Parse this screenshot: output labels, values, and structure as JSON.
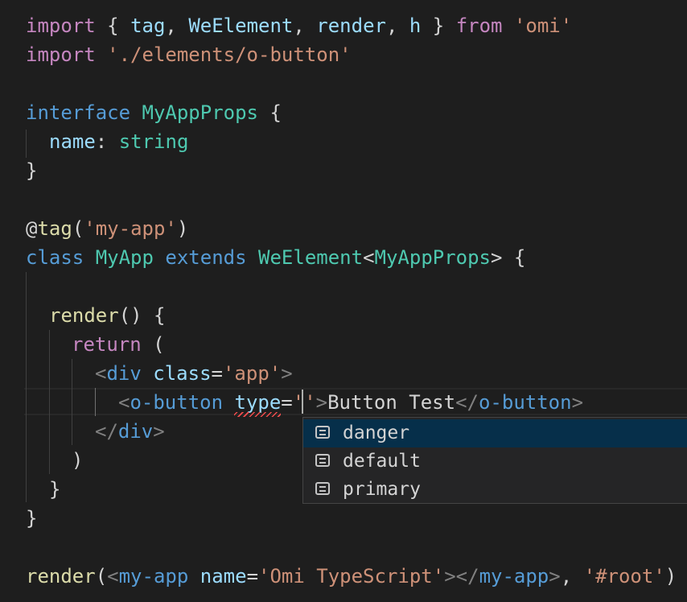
{
  "code": {
    "line1": {
      "k1": "import",
      "p1": " { ",
      "v1": "tag",
      "p2": ", ",
      "v2": "WeElement",
      "p3": ", ",
      "v3": "render",
      "p4": ", ",
      "v4": "h",
      "p5": " } ",
      "k2": "from",
      "p6": " ",
      "s1": "'omi'"
    },
    "line2": {
      "k1": "import",
      "p1": " ",
      "s1": "'./elements/o-button'"
    },
    "line4": {
      "k1": "interface",
      "p1": " ",
      "c1": "MyAppProps",
      "p2": " {"
    },
    "line5": {
      "v1": "name",
      "p1": ": ",
      "c1": "string"
    },
    "line6": {
      "p1": "}"
    },
    "line8": {
      "p1": "@",
      "f1": "tag",
      "p2": "(",
      "s1": "'my-app'",
      "p3": ")"
    },
    "line9": {
      "k1": "class",
      "p1": " ",
      "c1": "MyApp",
      "p2": " ",
      "k2": "extends",
      "p3": " ",
      "c2": "WeElement",
      "p4": "<",
      "c3": "MyAppProps",
      "p5": "> {"
    },
    "line11": {
      "f1": "render",
      "p1": "() {"
    },
    "line12": {
      "k1": "return",
      "p1": " ("
    },
    "line13": {
      "t1": "<",
      "n1": "div",
      "p1": " ",
      "a1": "class",
      "p2": "=",
      "s1": "'app'",
      "t2": ">"
    },
    "line14": {
      "t1": "<",
      "n1": "o-button",
      "p1": " ",
      "a1": "type",
      "p2": "=",
      "s1": "''",
      "t2": ">",
      "p3": "Button Test",
      "t3": "</",
      "n2": "o-button",
      "t4": ">"
    },
    "line15": {
      "t1": "</",
      "n1": "div",
      "t2": ">"
    },
    "line16": {
      "p1": ")"
    },
    "line17": {
      "p1": "}"
    },
    "line18": {
      "p1": "}"
    },
    "line20": {
      "f1": "render",
      "p1": "(",
      "t1": "<",
      "n1": "my-app",
      "p2": " ",
      "a1": "name",
      "p3": "=",
      "s1": "'Omi TypeScript'",
      "t2": "></",
      "n2": "my-app",
      "t3": ">",
      "p4": ", ",
      "s2": "'#root'",
      "p5": ")"
    }
  },
  "suggestions": [
    {
      "label": "danger",
      "icon": "enum-member-icon",
      "selected": true
    },
    {
      "label": "default",
      "icon": "enum-member-icon",
      "selected": false
    },
    {
      "label": "primary",
      "icon": "enum-member-icon",
      "selected": false
    }
  ],
  "colors": {
    "background": "#1e1e1e",
    "keyword": "#c586c0",
    "storage": "#569cd6",
    "function": "#dcdcaa",
    "variable": "#9cdcfe",
    "type": "#4ec9b0",
    "string": "#ce9178",
    "tag_bracket": "#808080",
    "suggest_selected": "#062f4a",
    "error_squiggle": "#f14c4c"
  }
}
